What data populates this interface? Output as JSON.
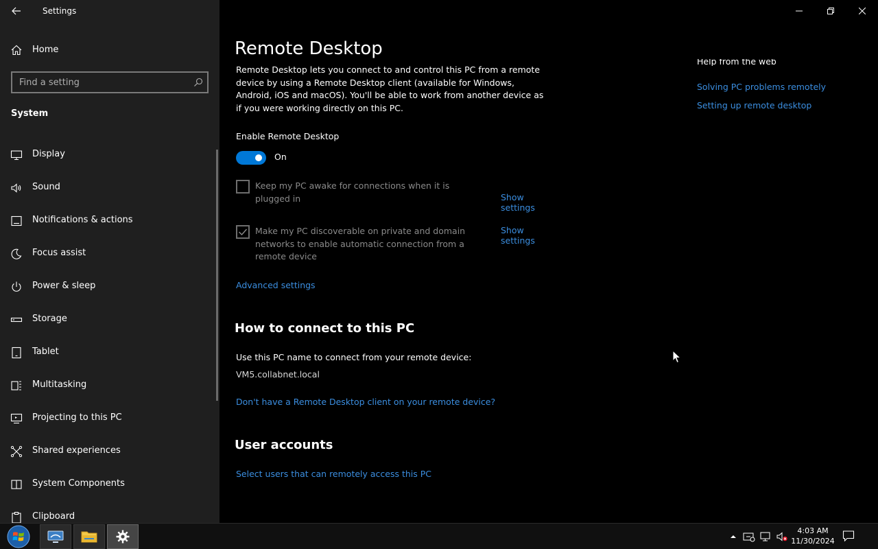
{
  "window": {
    "title": "Settings"
  },
  "sidebar": {
    "home_label": "Home",
    "search_placeholder": "Find a setting",
    "section_title": "System",
    "items": [
      {
        "label": "Display",
        "icon": "display-icon"
      },
      {
        "label": "Sound",
        "icon": "sound-icon"
      },
      {
        "label": "Notifications & actions",
        "icon": "notifications-icon"
      },
      {
        "label": "Focus assist",
        "icon": "focus-assist-icon"
      },
      {
        "label": "Power & sleep",
        "icon": "power-icon"
      },
      {
        "label": "Storage",
        "icon": "storage-icon"
      },
      {
        "label": "Tablet",
        "icon": "tablet-icon"
      },
      {
        "label": "Multitasking",
        "icon": "multitasking-icon"
      },
      {
        "label": "Projecting to this PC",
        "icon": "projecting-icon"
      },
      {
        "label": "Shared experiences",
        "icon": "shared-experiences-icon"
      },
      {
        "label": "System Components",
        "icon": "system-components-icon"
      },
      {
        "label": "Clipboard",
        "icon": "clipboard-icon"
      }
    ]
  },
  "main": {
    "title": "Remote Desktop",
    "description": "Remote Desktop lets you connect to and control this PC from a remote device by using a Remote Desktop client (available for Windows, Android, iOS and macOS). You'll be able to work from another device as if you were working directly on this PC.",
    "enable_label": "Enable Remote Desktop",
    "toggle_state": "On",
    "toggle_on": true,
    "option_awake": {
      "label": "Keep my PC awake for connections when it is plugged in",
      "checked": false,
      "link": "Show settings"
    },
    "option_discoverable": {
      "label": "Make my PC discoverable on private and domain networks to enable automatic connection from a remote device",
      "checked": true,
      "link": "Show settings"
    },
    "advanced_link": "Advanced settings",
    "how_heading": "How to connect to this PC",
    "use_name_text": "Use this PC name to connect from your remote device:",
    "pc_name": "VM5.collabnet.local",
    "no_client_link": "Don't have a Remote Desktop client on your remote device?",
    "user_heading": "User accounts",
    "select_users_link": "Select users that can remotely access this PC"
  },
  "help": {
    "title": "Help from the web",
    "links": [
      "Solving PC problems remotely",
      "Setting up remote desktop"
    ]
  },
  "taskbar": {
    "time": "4:03 AM",
    "date": "11/30/2024"
  },
  "colors": {
    "accent": "#0078d7",
    "link": "#3b8ee0",
    "sidebar_bg": "#1f1f1f",
    "main_bg": "#000000"
  }
}
